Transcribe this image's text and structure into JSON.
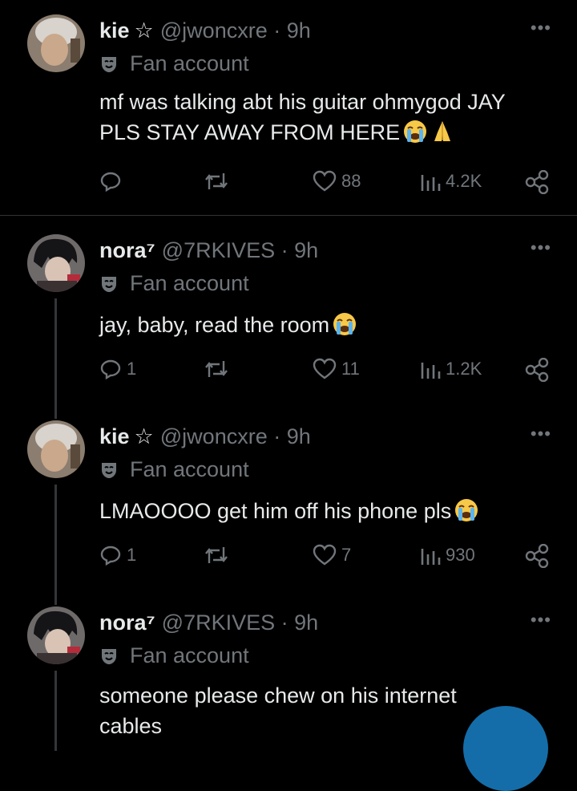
{
  "tweets": [
    {
      "name": "kie",
      "badge": "☆",
      "handle": "@jwoncxre · 9h",
      "label": "Fan account",
      "text": "mf was talking abt his guitar ohmygod JAY PLS STAY AWAY FROM HERE",
      "emojis": [
        "crying-face",
        "folded-hands"
      ],
      "replies": "",
      "likes": "88",
      "views": "4.2K"
    },
    {
      "name": "nora⁷",
      "badge": "",
      "handle": "@7RKIVES · 9h",
      "label": "Fan account",
      "text": "jay, baby, read the room",
      "emojis": [
        "crying-face"
      ],
      "replies": "1",
      "likes": "11",
      "views": "1.2K"
    },
    {
      "name": "kie",
      "badge": "☆",
      "handle": "@jwoncxre · 9h",
      "label": "Fan account",
      "text": "LMAOOOO get him off his phone pls",
      "emojis": [
        "crying-face"
      ],
      "replies": "1",
      "likes": "7",
      "views": "930"
    },
    {
      "name": "nora⁷",
      "badge": "",
      "handle": "@7RKIVES · 9h",
      "label": "Fan account",
      "text": "someone please chew on his internet cables",
      "emojis": [],
      "replies": "",
      "likes": "",
      "views": ""
    }
  ],
  "more_glyph": "•••",
  "colors": {
    "background": "#000000",
    "text": "#e7e9ea",
    "muted": "#71767b",
    "accent": "#1d9bf0"
  }
}
